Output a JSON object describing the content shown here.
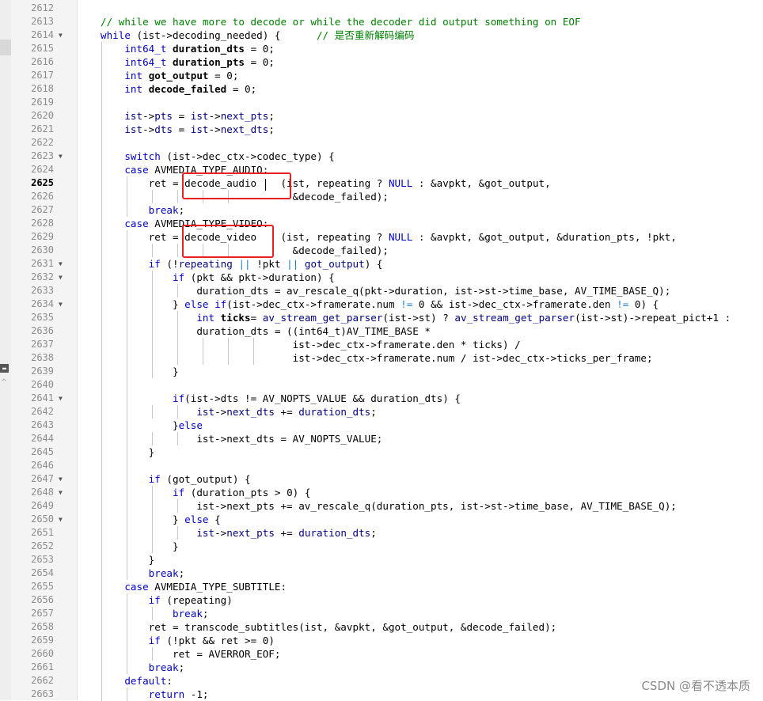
{
  "editor": {
    "current_line": "2625",
    "lines": [
      {
        "n": "2612",
        "fold": "",
        "g": [],
        "segs": []
      },
      {
        "n": "2613",
        "fold": "",
        "g": [],
        "segs": [
          {
            "t": "// while we have more to decode or while the decoder did output something on EOF",
            "c": "cm"
          }
        ]
      },
      {
        "n": "2614",
        "fold": "▼",
        "g": [],
        "segs": [
          {
            "t": "while",
            "c": "kw"
          },
          {
            "t": " (ist->decoding_needed) {      "
          },
          {
            "t": "// 是否重新解码编码",
            "c": "cm"
          }
        ]
      },
      {
        "n": "2615",
        "fold": "",
        "g": [
          0
        ],
        "segs": [
          {
            "t": "    "
          },
          {
            "t": "int64_t",
            "c": "kw"
          },
          {
            "t": " "
          },
          {
            "t": "duration_dts",
            "c": "b"
          },
          {
            "t": " = 0;"
          }
        ]
      },
      {
        "n": "2616",
        "fold": "",
        "g": [
          0
        ],
        "segs": [
          {
            "t": "    "
          },
          {
            "t": "int64_t",
            "c": "kw"
          },
          {
            "t": " "
          },
          {
            "t": "duration_pts",
            "c": "b"
          },
          {
            "t": " = 0;"
          }
        ]
      },
      {
        "n": "2617",
        "fold": "",
        "g": [
          0
        ],
        "segs": [
          {
            "t": "    "
          },
          {
            "t": "int",
            "c": "kw"
          },
          {
            "t": " "
          },
          {
            "t": "got_output",
            "c": "b"
          },
          {
            "t": " = 0;"
          }
        ]
      },
      {
        "n": "2618",
        "fold": "",
        "g": [
          0
        ],
        "segs": [
          {
            "t": "    "
          },
          {
            "t": "int",
            "c": "kw"
          },
          {
            "t": " "
          },
          {
            "t": "decode_failed",
            "c": "b"
          },
          {
            "t": " = 0;"
          }
        ]
      },
      {
        "n": "2619",
        "fold": "",
        "g": [
          0
        ],
        "segs": []
      },
      {
        "n": "2620",
        "fold": "",
        "g": [
          0
        ],
        "segs": [
          {
            "t": "    "
          },
          {
            "t": "ist",
            "c": "id"
          },
          {
            "t": "->"
          },
          {
            "t": "pts",
            "c": "id"
          },
          {
            "t": " = "
          },
          {
            "t": "ist",
            "c": "id"
          },
          {
            "t": "->"
          },
          {
            "t": "next_pts",
            "c": "id"
          },
          {
            "t": ";"
          }
        ]
      },
      {
        "n": "2621",
        "fold": "",
        "g": [
          0
        ],
        "segs": [
          {
            "t": "    "
          },
          {
            "t": "ist",
            "c": "id"
          },
          {
            "t": "->"
          },
          {
            "t": "dts",
            "c": "id"
          },
          {
            "t": " = "
          },
          {
            "t": "ist",
            "c": "id"
          },
          {
            "t": "->"
          },
          {
            "t": "next_dts",
            "c": "id"
          },
          {
            "t": ";"
          }
        ]
      },
      {
        "n": "2622",
        "fold": "",
        "g": [
          0
        ],
        "segs": []
      },
      {
        "n": "2623",
        "fold": "▼",
        "g": [
          0
        ],
        "segs": [
          {
            "t": "    "
          },
          {
            "t": "switch",
            "c": "kw"
          },
          {
            "t": " (ist->dec_ctx->codec_type) {"
          }
        ]
      },
      {
        "n": "2624",
        "fold": "",
        "g": [
          0
        ],
        "segs": [
          {
            "t": "    "
          },
          {
            "t": "case",
            "c": "kw"
          },
          {
            "t": " AVMEDIA_TYPE_AUDIO:"
          }
        ]
      },
      {
        "n": "2625",
        "fold": "",
        "g": [
          0,
          1
        ],
        "segs": [
          {
            "t": "        ret = decode_audio    (ist, repeating ? "
          },
          {
            "t": "NULL",
            "c": "kw"
          },
          {
            "t": " : &avpkt, &got_output,"
          }
        ]
      },
      {
        "n": "2626",
        "fold": "",
        "g": [
          0,
          1,
          2,
          3,
          4,
          5
        ],
        "segs": [
          {
            "t": "                                &decode_failed);"
          }
        ]
      },
      {
        "n": "2627",
        "fold": "",
        "g": [
          0,
          1
        ],
        "segs": [
          {
            "t": "        "
          },
          {
            "t": "break",
            "c": "kw"
          },
          {
            "t": ";"
          }
        ]
      },
      {
        "n": "2628",
        "fold": "",
        "g": [
          0
        ],
        "segs": [
          {
            "t": "    "
          },
          {
            "t": "case",
            "c": "kw"
          },
          {
            "t": " AVMEDIA_TYPE_VIDEO:"
          }
        ]
      },
      {
        "n": "2629",
        "fold": "",
        "g": [
          0,
          1
        ],
        "segs": [
          {
            "t": "        ret = decode_video    (ist, repeating ? "
          },
          {
            "t": "NULL",
            "c": "kw"
          },
          {
            "t": " : &avpkt, &got_output, &duration_pts, !pkt,"
          }
        ]
      },
      {
        "n": "2630",
        "fold": "",
        "g": [
          0,
          1,
          2,
          3,
          4,
          5
        ],
        "segs": [
          {
            "t": "                                &decode_failed);"
          }
        ]
      },
      {
        "n": "2631",
        "fold": "▼",
        "g": [
          0,
          1
        ],
        "segs": [
          {
            "t": "        "
          },
          {
            "t": "if",
            "c": "kw"
          },
          {
            "t": " (!"
          },
          {
            "t": "repeating",
            "c": "id"
          },
          {
            "t": " "
          },
          {
            "t": "||",
            "c": "h"
          },
          {
            "t": " !pkt "
          },
          {
            "t": "||",
            "c": "h"
          },
          {
            "t": " "
          },
          {
            "t": "got_output",
            "c": "id"
          },
          {
            "t": ") {"
          }
        ]
      },
      {
        "n": "2632",
        "fold": "▼",
        "g": [
          0,
          1,
          2
        ],
        "segs": [
          {
            "t": "            "
          },
          {
            "t": "if",
            "c": "kw"
          },
          {
            "t": " (pkt && pkt->duration) {"
          }
        ]
      },
      {
        "n": "2633",
        "fold": "",
        "g": [
          0,
          1,
          2,
          3
        ],
        "segs": [
          {
            "t": "                duration_dts = av_rescale_q(pkt->duration, ist->st->time_base, AV_TIME_BASE_Q);"
          }
        ]
      },
      {
        "n": "2634",
        "fold": "▼",
        "g": [
          0,
          1,
          2
        ],
        "segs": [
          {
            "t": "            } "
          },
          {
            "t": "else",
            "c": "kw"
          },
          {
            "t": " "
          },
          {
            "t": "if",
            "c": "kw"
          },
          {
            "t": "(ist->dec_ctx->framerate.num "
          },
          {
            "t": "!=",
            "c": "h"
          },
          {
            "t": " 0 && ist->dec_ctx->framerate.den "
          },
          {
            "t": "!=",
            "c": "h"
          },
          {
            "t": " 0) {"
          }
        ]
      },
      {
        "n": "2635",
        "fold": "",
        "g": [
          0,
          1,
          2,
          3
        ],
        "segs": [
          {
            "t": "                "
          },
          {
            "t": "int",
            "c": "kw"
          },
          {
            "t": " "
          },
          {
            "t": "ticks",
            "c": "b"
          },
          {
            "t": "= "
          },
          {
            "t": "av_stream_get_parser",
            "c": "id"
          },
          {
            "t": "(ist->st) ? "
          },
          {
            "t": "av_stream_get_parser",
            "c": "id"
          },
          {
            "t": "(ist->st)->repeat_pict+1 :"
          }
        ]
      },
      {
        "n": "2636",
        "fold": "",
        "g": [
          0,
          1,
          2,
          3
        ],
        "segs": [
          {
            "t": "                duration_dts = ((int64_t)AV_TIME_BASE *"
          }
        ]
      },
      {
        "n": "2637",
        "fold": "",
        "g": [
          0,
          1,
          2,
          3,
          4,
          5,
          6
        ],
        "segs": [
          {
            "t": "                                ist->dec_ctx->framerate.den * ticks) /"
          }
        ]
      },
      {
        "n": "2638",
        "fold": "",
        "g": [
          0,
          1,
          2,
          3,
          4,
          5,
          6
        ],
        "segs": [
          {
            "t": "                                ist->dec_ctx->framerate.num / ist->dec_ctx->ticks_per_frame;"
          }
        ]
      },
      {
        "n": "2639",
        "fold": "",
        "g": [
          0,
          1,
          2
        ],
        "segs": [
          {
            "t": "            }"
          }
        ]
      },
      {
        "n": "2640",
        "fold": "",
        "g": [
          0,
          1
        ],
        "segs": []
      },
      {
        "n": "2641",
        "fold": "▼",
        "g": [
          0,
          1
        ],
        "segs": [
          {
            "t": "            "
          },
          {
            "t": "if",
            "c": "kw"
          },
          {
            "t": "(ist->dts != AV_NOPTS_VALUE && duration_dts) {"
          }
        ]
      },
      {
        "n": "2642",
        "fold": "",
        "g": [
          0,
          1,
          2,
          3
        ],
        "segs": [
          {
            "t": "                "
          },
          {
            "t": "ist",
            "c": "id"
          },
          {
            "t": "->"
          },
          {
            "t": "next_dts",
            "c": "id"
          },
          {
            "t": " += "
          },
          {
            "t": "duration_dts",
            "c": "id"
          },
          {
            "t": ";"
          }
        ]
      },
      {
        "n": "2643",
        "fold": "",
        "g": [
          0,
          1
        ],
        "segs": [
          {
            "t": "            }"
          },
          {
            "t": "else",
            "c": "kw"
          }
        ]
      },
      {
        "n": "2644",
        "fold": "",
        "g": [
          0,
          1,
          2,
          3
        ],
        "segs": [
          {
            "t": "                ist->next_dts = AV_NOPTS_VALUE;"
          }
        ]
      },
      {
        "n": "2645",
        "fold": "",
        "g": [
          0,
          1
        ],
        "segs": [
          {
            "t": "        }"
          }
        ]
      },
      {
        "n": "2646",
        "fold": "",
        "g": [
          0,
          1
        ],
        "segs": []
      },
      {
        "n": "2647",
        "fold": "▼",
        "g": [
          0,
          1
        ],
        "segs": [
          {
            "t": "        "
          },
          {
            "t": "if",
            "c": "kw"
          },
          {
            "t": " (got_output) {"
          }
        ]
      },
      {
        "n": "2648",
        "fold": "▼",
        "g": [
          0,
          1,
          2
        ],
        "segs": [
          {
            "t": "            "
          },
          {
            "t": "if",
            "c": "kw"
          },
          {
            "t": " (duration_pts > 0) {"
          }
        ]
      },
      {
        "n": "2649",
        "fold": "",
        "g": [
          0,
          1,
          2,
          3
        ],
        "segs": [
          {
            "t": "                ist->next_pts += av_rescale_q(duration_pts, ist->st->time_base, AV_TIME_BASE_Q);"
          }
        ]
      },
      {
        "n": "2650",
        "fold": "▼",
        "g": [
          0,
          1,
          2
        ],
        "segs": [
          {
            "t": "            } "
          },
          {
            "t": "else",
            "c": "kw"
          },
          {
            "t": " {"
          }
        ]
      },
      {
        "n": "2651",
        "fold": "",
        "g": [
          0,
          1,
          2,
          3
        ],
        "segs": [
          {
            "t": "                "
          },
          {
            "t": "ist",
            "c": "id"
          },
          {
            "t": "->"
          },
          {
            "t": "next_pts",
            "c": "id"
          },
          {
            "t": " += "
          },
          {
            "t": "duration_dts",
            "c": "id"
          },
          {
            "t": ";"
          }
        ]
      },
      {
        "n": "2652",
        "fold": "",
        "g": [
          0,
          1,
          2
        ],
        "segs": [
          {
            "t": "            }"
          }
        ]
      },
      {
        "n": "2653",
        "fold": "",
        "g": [
          0,
          1
        ],
        "segs": [
          {
            "t": "        }"
          }
        ]
      },
      {
        "n": "2654",
        "fold": "",
        "g": [
          0,
          1
        ],
        "segs": [
          {
            "t": "        "
          },
          {
            "t": "break",
            "c": "kw"
          },
          {
            "t": ";"
          }
        ]
      },
      {
        "n": "2655",
        "fold": "",
        "g": [
          0
        ],
        "segs": [
          {
            "t": "    "
          },
          {
            "t": "case",
            "c": "kw"
          },
          {
            "t": " AVMEDIA_TYPE_SUBTITLE:"
          }
        ]
      },
      {
        "n": "2656",
        "fold": "",
        "g": [
          0,
          1
        ],
        "segs": [
          {
            "t": "        "
          },
          {
            "t": "if",
            "c": "kw"
          },
          {
            "t": " (repeating)"
          }
        ]
      },
      {
        "n": "2657",
        "fold": "",
        "g": [
          0,
          1,
          2
        ],
        "segs": [
          {
            "t": "            "
          },
          {
            "t": "break",
            "c": "kw"
          },
          {
            "t": ";"
          }
        ]
      },
      {
        "n": "2658",
        "fold": "",
        "g": [
          0,
          1
        ],
        "segs": [
          {
            "t": "        ret = transcode_subtitles(ist, &avpkt, &got_output, &decode_failed);"
          }
        ]
      },
      {
        "n": "2659",
        "fold": "",
        "g": [
          0,
          1
        ],
        "segs": [
          {
            "t": "        "
          },
          {
            "t": "if",
            "c": "kw"
          },
          {
            "t": " (!pkt && ret >= 0)"
          }
        ]
      },
      {
        "n": "2660",
        "fold": "",
        "g": [
          0,
          1,
          2
        ],
        "segs": [
          {
            "t": "            ret = AVERROR_EOF;"
          }
        ]
      },
      {
        "n": "2661",
        "fold": "",
        "g": [
          0,
          1
        ],
        "segs": [
          {
            "t": "        "
          },
          {
            "t": "break",
            "c": "kw"
          },
          {
            "t": ";"
          }
        ]
      },
      {
        "n": "2662",
        "fold": "",
        "g": [
          0
        ],
        "segs": [
          {
            "t": "    "
          },
          {
            "t": "default",
            "c": "kw"
          },
          {
            "t": ":"
          }
        ]
      },
      {
        "n": "2663",
        "fold": "",
        "g": [
          0,
          1
        ],
        "segs": [
          {
            "t": "        "
          },
          {
            "t": "return",
            "c": "kw"
          },
          {
            "t": " -1;"
          }
        ]
      }
    ]
  },
  "watermark": "CSDN @看不透本质",
  "colors": {
    "comment": "#008000",
    "keyword": "#0000c8",
    "highlight_box": "#e82020"
  },
  "icons": {
    "fold": "fold-triangle-icon",
    "panel_toggle": "panel-toggle-icon",
    "scroll_up": "chevron-up-icon"
  }
}
